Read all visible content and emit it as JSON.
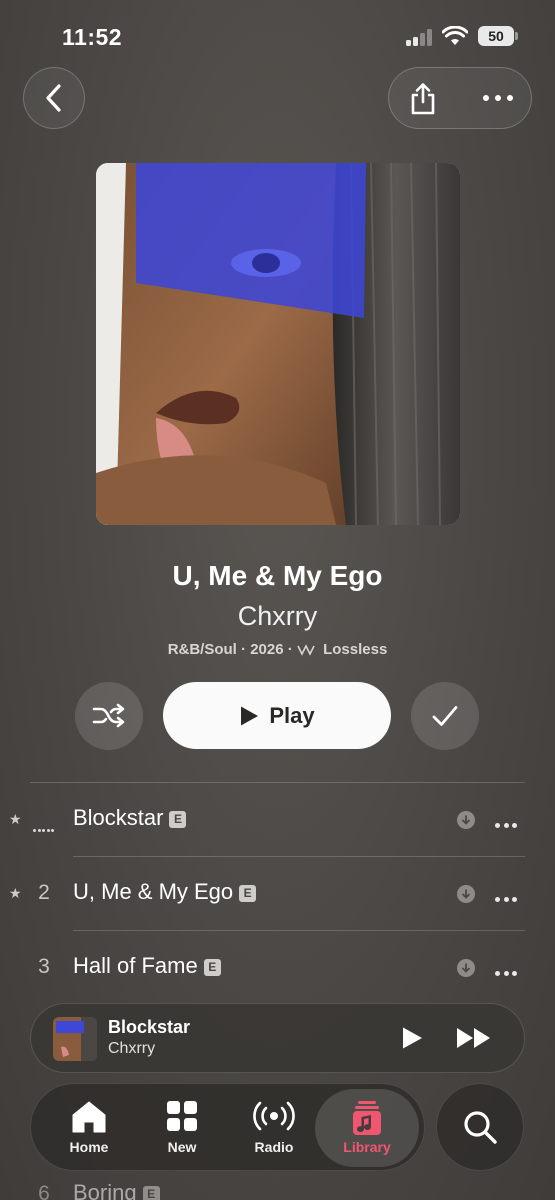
{
  "status": {
    "time": "11:52",
    "battery": "50"
  },
  "album": {
    "title": "U, Me & My Ego",
    "artist": "Chxrry",
    "genre": "R&B/Soul",
    "year": "2026",
    "quality": "Lossless",
    "separator": "·"
  },
  "actions": {
    "play_label": "Play"
  },
  "tracks": [
    {
      "number": "",
      "title": "Blockstar",
      "explicit": "E",
      "favorite": true,
      "playing": true
    },
    {
      "number": "2",
      "title": "U, Me & My Ego",
      "explicit": "E",
      "favorite": true,
      "playing": false
    },
    {
      "number": "3",
      "title": "Hall of Fame",
      "explicit": "E",
      "favorite": false,
      "playing": false
    },
    {
      "number": "6",
      "title": "Boring",
      "explicit": "E",
      "favorite": false,
      "playing": false
    }
  ],
  "now_playing": {
    "title": "Blockstar",
    "artist": "Chxrry"
  },
  "tabs": [
    {
      "label": "Home",
      "icon": "home-icon"
    },
    {
      "label": "New",
      "icon": "grid-icon"
    },
    {
      "label": "Radio",
      "icon": "radio-icon"
    },
    {
      "label": "Library",
      "icon": "library-icon",
      "active": true
    }
  ],
  "colors": {
    "accent": "#f05670",
    "background": "#4a4744"
  }
}
